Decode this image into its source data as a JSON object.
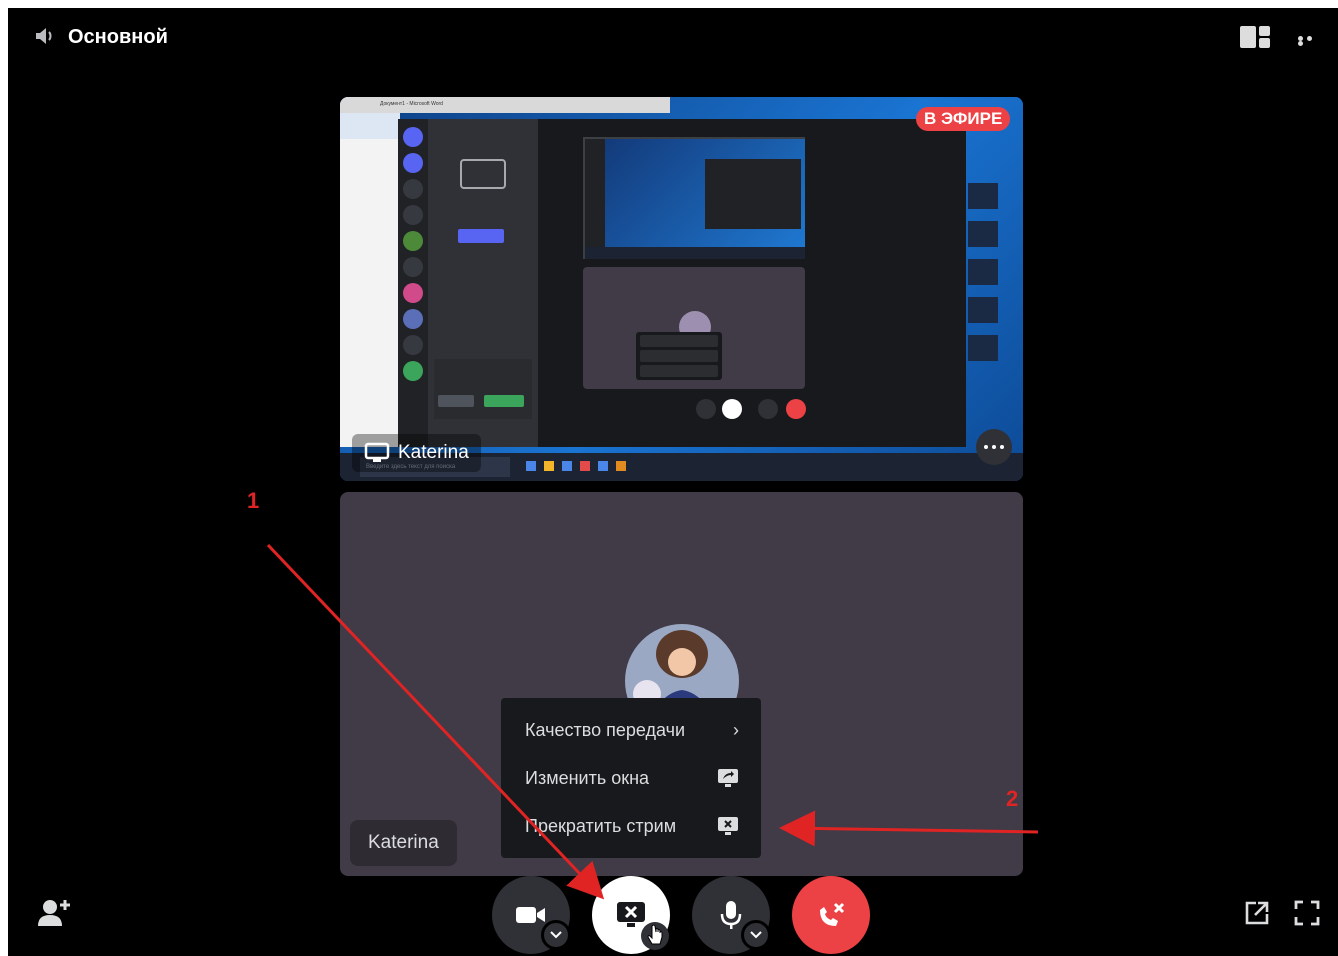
{
  "header": {
    "channel_name": "Основной",
    "speaker_icon": "speaker-icon",
    "layout_icon": "grid-layout-icon",
    "more_icon": "more-icon"
  },
  "stream_tile": {
    "live_badge": "В ЭФИРЕ",
    "user_name": "Katerina",
    "screen_icon": "monitor-icon",
    "nested": {
      "word_title": "Документ1 - Microsoft Word",
      "search_placeholder": "Введите здесь текст для поиска"
    }
  },
  "user_tile": {
    "user_name": "Katerina"
  },
  "context_menu": {
    "items": [
      {
        "label": "Качество передачи",
        "icon": "chevron-right-icon",
        "glyph": "›"
      },
      {
        "label": "Изменить окна",
        "icon": "screen-switch-icon"
      },
      {
        "label": "Прекратить стрим",
        "icon": "stop-stream-icon"
      }
    ]
  },
  "controls": {
    "camera": "camera-icon",
    "screen_share": "stop-share-icon",
    "microphone": "microphone-icon",
    "disconnect": "disconnect-icon"
  },
  "annotations": {
    "label1": "1",
    "label2": "2",
    "color": "#e02424"
  },
  "colors": {
    "background": "#000000",
    "tile": "#413a47",
    "menu": "#18191c",
    "danger": "#ed4245",
    "live": "#ed4245"
  }
}
